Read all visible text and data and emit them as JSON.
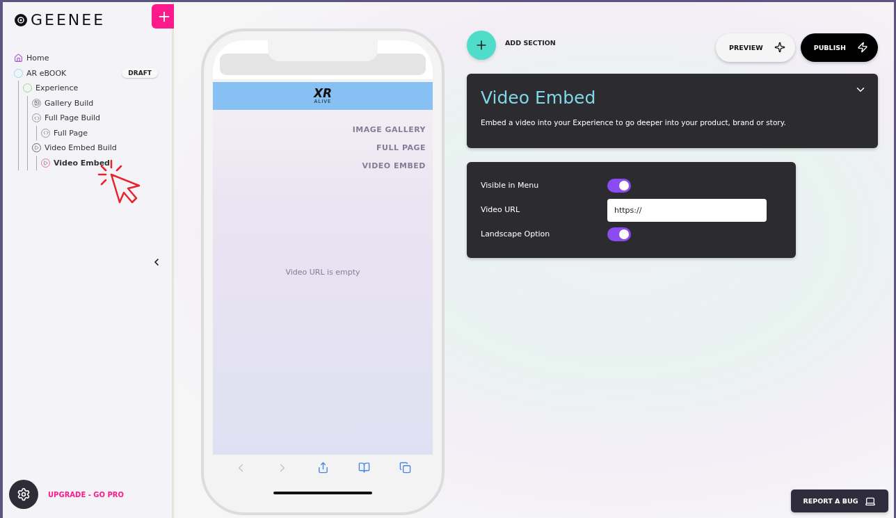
{
  "brand": {
    "name": "GEENEE"
  },
  "sidebar": {
    "tree": [
      {
        "label": "Home",
        "kind": "home",
        "selected": false
      },
      {
        "label": "AR eBOOK",
        "kind": "project",
        "selected": false,
        "badge": "DRAFT",
        "children": [
          {
            "label": "Experience",
            "kind": "experience",
            "selected": false,
            "children": [
              {
                "label": "Gallery Build",
                "kind": "gallery",
                "selected": false
              },
              {
                "label": "Full Page Build",
                "kind": "code",
                "selected": false,
                "children": [
                  {
                    "label": "Full Page",
                    "kind": "code",
                    "selected": false
                  }
                ]
              },
              {
                "label": "Video Embed Build",
                "kind": "play",
                "selected": false,
                "children": [
                  {
                    "label": "Video Embed",
                    "kind": "play",
                    "selected": true
                  }
                ]
              }
            ]
          }
        ]
      }
    ],
    "upgrade": "UPGRADE - GO PRO"
  },
  "phone": {
    "logo": {
      "top": "XR",
      "bottom": "ALIVE"
    },
    "menu": [
      "IMAGE GALLERY",
      "FULL PAGE",
      "VIDEO EMBED"
    ],
    "message": "Video URL is empty",
    "browser_nav": [
      {
        "kind": "back",
        "disabled": true
      },
      {
        "kind": "forward",
        "disabled": true
      },
      {
        "kind": "share",
        "disabled": false
      },
      {
        "kind": "bookmarks",
        "disabled": false
      },
      {
        "kind": "tabs",
        "disabled": false
      }
    ]
  },
  "toolbar": {
    "add_section": "ADD SECTION",
    "preview": "PREVIEW",
    "publish": "PUBLISH"
  },
  "section": {
    "title": "Video Embed",
    "description": "Embed a video into your Experience to go deeper into your product, brand or story."
  },
  "settings": [
    {
      "kind": "toggle",
      "label": "Visible in Menu",
      "on": true
    },
    {
      "kind": "text",
      "label": "Video URL",
      "value": "https://"
    },
    {
      "kind": "toggle",
      "label": "Landscape Option",
      "on": true
    }
  ],
  "report_bug": "REPORT A BUG"
}
